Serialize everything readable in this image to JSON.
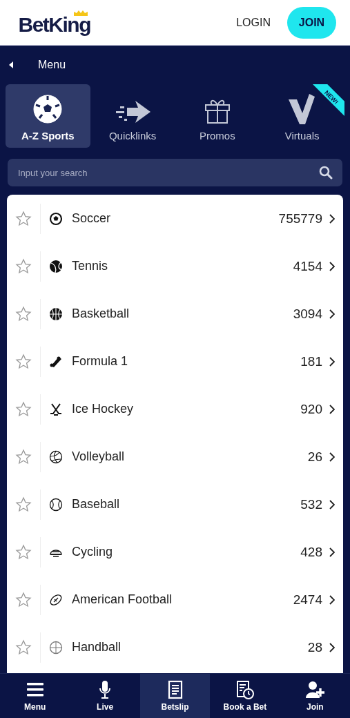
{
  "header": {
    "logo": "BetKing",
    "login": "LOGIN",
    "join": "JOIN"
  },
  "menu": {
    "back_label": "Menu"
  },
  "tiles": [
    {
      "label": "A-Z Sports",
      "selected": true
    },
    {
      "label": "Quicklinks",
      "selected": false
    },
    {
      "label": "Promos",
      "selected": false
    },
    {
      "label": "Virtuals",
      "selected": false,
      "badge": "NEW!"
    }
  ],
  "search": {
    "placeholder": "Input your search"
  },
  "sports": [
    {
      "name": "Soccer",
      "count": "755779",
      "favorite": false
    },
    {
      "name": "Tennis",
      "count": "4154",
      "favorite": false
    },
    {
      "name": "Basketball",
      "count": "3094",
      "favorite": false
    },
    {
      "name": "Formula 1",
      "count": "181",
      "favorite": false
    },
    {
      "name": "Ice Hockey",
      "count": "920",
      "favorite": false
    },
    {
      "name": "Volleyball",
      "count": "26",
      "favorite": false
    },
    {
      "name": "Baseball",
      "count": "532",
      "favorite": false
    },
    {
      "name": "Cycling",
      "count": "428",
      "favorite": false
    },
    {
      "name": "American Football",
      "count": "2474",
      "favorite": false
    },
    {
      "name": "Handball",
      "count": "28",
      "favorite": false
    }
  ],
  "bottom_nav": [
    {
      "label": "Menu",
      "selected": false
    },
    {
      "label": "Live",
      "selected": false
    },
    {
      "label": "Betslip",
      "selected": true
    },
    {
      "label": "Book a Bet",
      "selected": false
    },
    {
      "label": "Join",
      "selected": false
    }
  ]
}
